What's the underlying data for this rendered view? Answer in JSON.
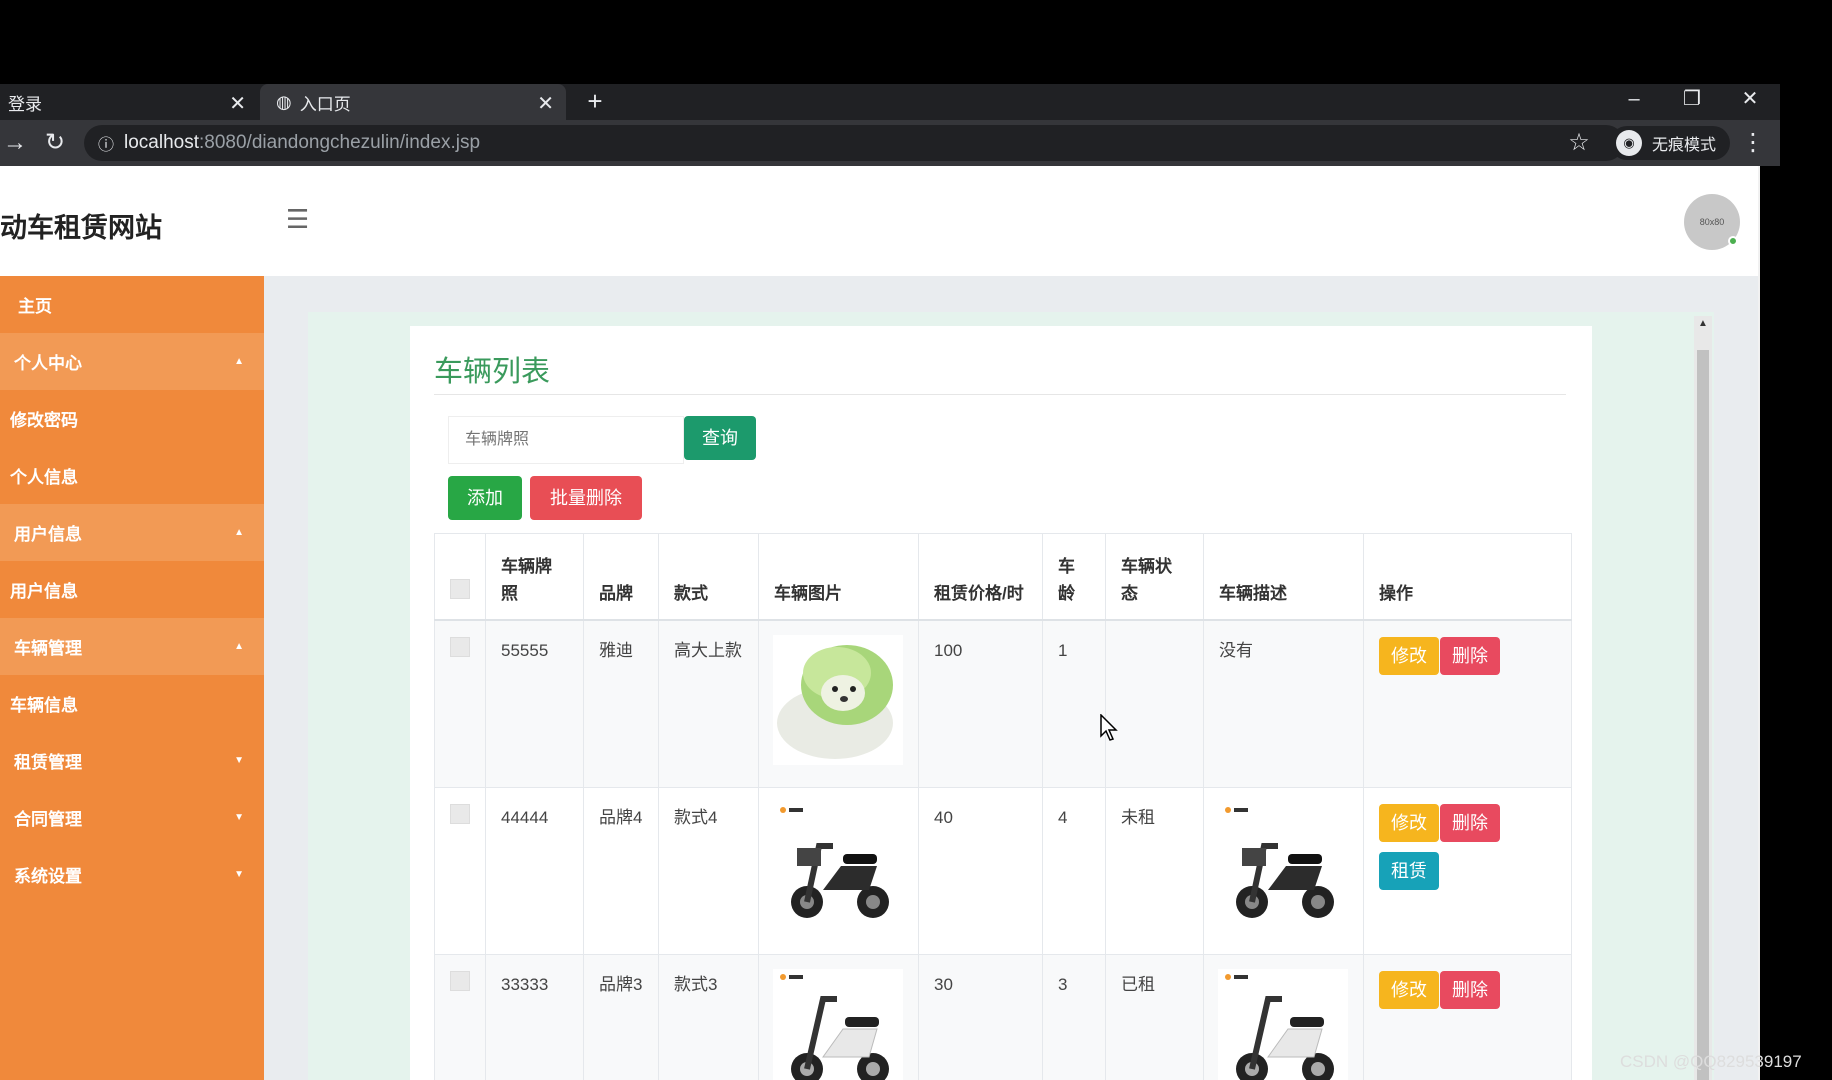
{
  "browser": {
    "tabs": [
      {
        "title": "登录"
      },
      {
        "title": "入口页"
      }
    ],
    "new_tab": "+",
    "address": {
      "host": "localhost",
      "path": ":8080/diandongchezulin/index.jsp"
    },
    "incognito_label": "无痕模式"
  },
  "site": {
    "title": "动车租赁网站",
    "avatar_text": "80x80"
  },
  "sidebar": {
    "items": [
      {
        "label": "主页",
        "type": "link"
      },
      {
        "label": "个人中心",
        "type": "parent",
        "expanded": true
      },
      {
        "label": "修改密码",
        "type": "child"
      },
      {
        "label": "个人信息",
        "type": "child"
      },
      {
        "label": "用户信息",
        "type": "parent",
        "expanded": true
      },
      {
        "label": "用户信息",
        "type": "child"
      },
      {
        "label": "车辆管理",
        "type": "parent",
        "expanded": true
      },
      {
        "label": "车辆信息",
        "type": "child"
      },
      {
        "label": "租赁管理",
        "type": "parent",
        "expanded": false
      },
      {
        "label": "合同管理",
        "type": "parent",
        "expanded": false
      },
      {
        "label": "系统设置",
        "type": "parent",
        "expanded": false
      }
    ]
  },
  "main": {
    "title": "车辆列表",
    "search_placeholder": "车辆牌照",
    "query_label": "查询",
    "add_label": "添加",
    "bulk_delete_label": "批量删除",
    "table": {
      "headers": [
        "车辆牌照",
        "品牌",
        "款式",
        "车辆图片",
        "租赁价格/时",
        "车龄",
        "车辆状态",
        "车辆描述",
        "操作"
      ],
      "rows": [
        {
          "plate": "55555",
          "brand": "雅迪",
          "style": "高大上款",
          "image": "cabbage-dog-image",
          "price": "100",
          "age": "1",
          "status": "",
          "desc": "没有",
          "desc_is_image": false,
          "actions": [
            "修改",
            "删除"
          ]
        },
        {
          "plate": "44444",
          "brand": "品牌4",
          "style": "款式4",
          "image": "black-scooter-image",
          "price": "40",
          "age": "4",
          "status": "未租",
          "desc": "",
          "desc_is_image": true,
          "actions": [
            "修改",
            "删除",
            "租赁"
          ]
        },
        {
          "plate": "33333",
          "brand": "品牌3",
          "style": "款式3",
          "image": "white-scooter-image",
          "price": "30",
          "age": "3",
          "status": "已租",
          "desc": "",
          "desc_is_image": true,
          "actions": [
            "修改",
            "删除"
          ]
        }
      ]
    }
  },
  "watermark": "CSDN @QQ829539197",
  "colors": {
    "sidebar": "#f0893b",
    "sidebar_parent": "#f29a55",
    "title_green": "#3a9a5c",
    "query_btn": "#1c9a6c",
    "add_btn": "#28a745",
    "delete_btn": "#e84e55",
    "edit_btn": "#f6b51e",
    "rent_btn": "#17a2b8"
  }
}
